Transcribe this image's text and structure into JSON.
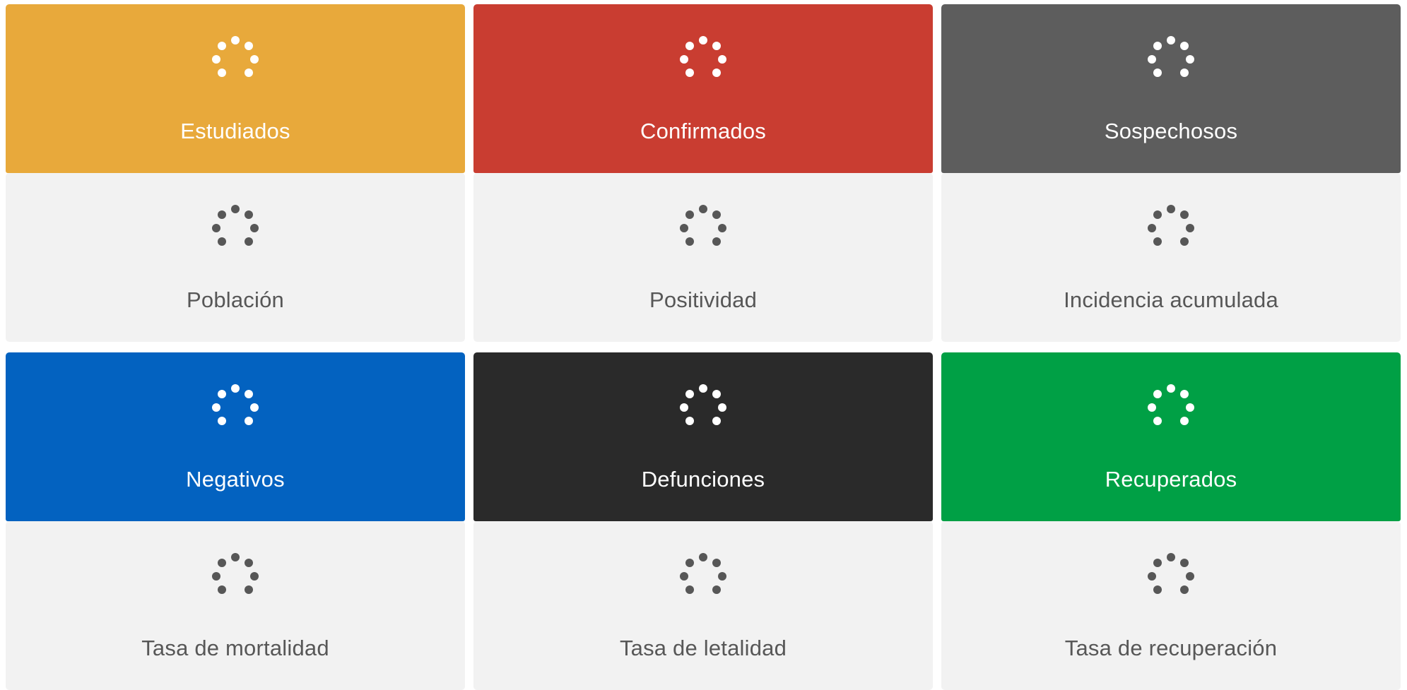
{
  "colors": {
    "estudiados": "#e8a93b",
    "confirmados": "#c93d31",
    "sospechosos": "#5d5d5d",
    "negativos": "#0362c0",
    "defunciones": "#2a2a2a",
    "recuperados": "#00a045",
    "secondary_bg": "#f2f2f2",
    "secondary_text": "#575757"
  },
  "icons": {
    "loading": "loading-spinner-icon"
  },
  "cards": {
    "estudiados": {
      "label": "Estudiados"
    },
    "confirmados": {
      "label": "Confirmados"
    },
    "sospechosos": {
      "label": "Sospechosos"
    },
    "poblacion": {
      "label": "Población"
    },
    "positividad": {
      "label": "Positividad"
    },
    "incidencia": {
      "label": "Incidencia acumulada"
    },
    "negativos": {
      "label": "Negativos"
    },
    "defunciones": {
      "label": "Defunciones"
    },
    "recuperados": {
      "label": "Recuperados"
    },
    "mortalidad": {
      "label": "Tasa de mortalidad"
    },
    "letalidad": {
      "label": "Tasa de letalidad"
    },
    "recuperacion": {
      "label": "Tasa de recuperación"
    }
  }
}
